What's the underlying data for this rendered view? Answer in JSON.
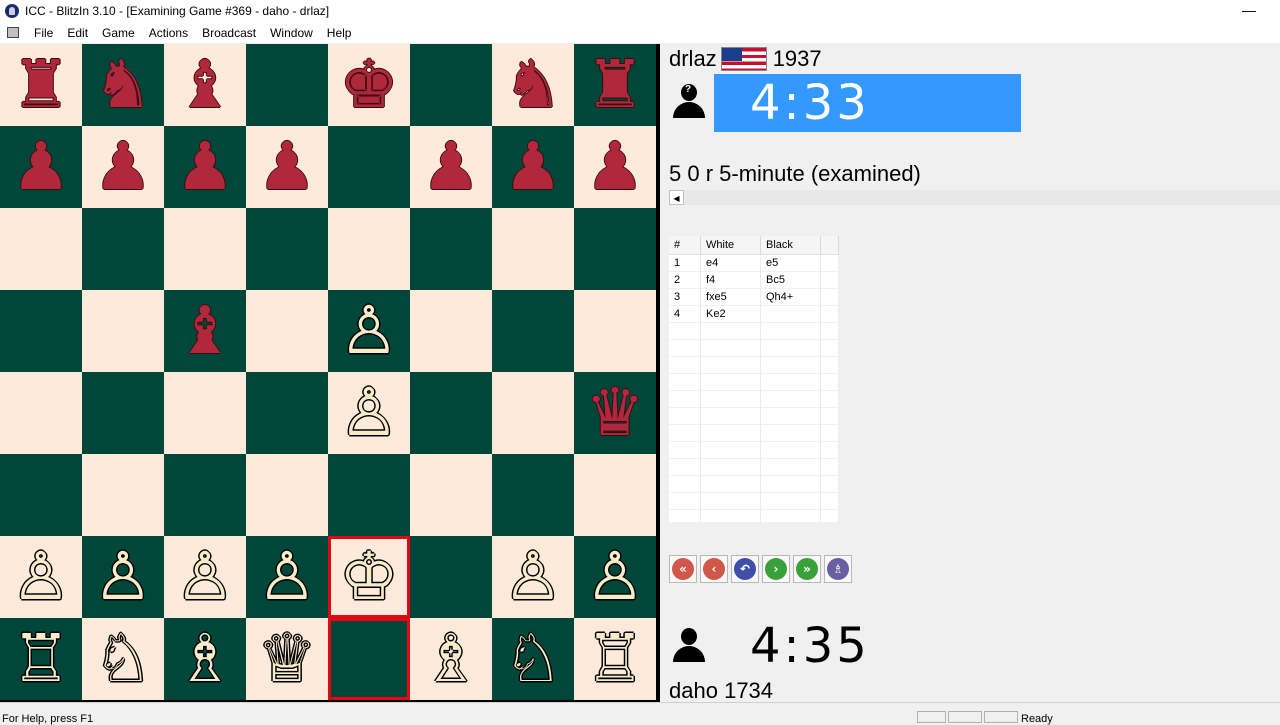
{
  "window": {
    "title": "ICC - BlitzIn 3.10 - [Examining Game #369 - daho - drlaz]",
    "minimize": "—"
  },
  "menu": [
    "File",
    "Edit",
    "Game",
    "Actions",
    "Broadcast",
    "Window",
    "Help"
  ],
  "board": {
    "light_color": "#feeadb",
    "dark_color": "#00473a",
    "highlight_color": "#e30613",
    "highlighted_squares": [
      "e2",
      "e1"
    ],
    "rows": [
      [
        "♜",
        "♞",
        "♝",
        "",
        "♚",
        "",
        "♞",
        "♜"
      ],
      [
        "♟",
        "♟",
        "♟",
        "♟",
        "",
        "♟",
        "♟",
        "♟"
      ],
      [
        "",
        "",
        "",
        "",
        "",
        "",
        "",
        ""
      ],
      [
        "",
        "",
        "♝",
        "",
        "♙",
        "",
        "",
        ""
      ],
      [
        "",
        "",
        "",
        "",
        "♙",
        "",
        "",
        "♛"
      ],
      [
        "",
        "",
        "",
        "",
        "",
        "",
        "",
        ""
      ],
      [
        "♙",
        "♙",
        "♙",
        "♙",
        "♔",
        "",
        "♙",
        "♙"
      ],
      [
        "♖",
        "♘",
        "♗",
        "♕",
        "",
        "♗",
        "♘",
        "♖"
      ]
    ],
    "colors": [
      [
        "b",
        "b",
        "b",
        "",
        "b",
        "",
        "b",
        "b"
      ],
      [
        "b",
        "b",
        "b",
        "b",
        "",
        "b",
        "b",
        "b"
      ],
      [
        "",
        "",
        "",
        "",
        "",
        "",
        "",
        ""
      ],
      [
        "",
        "",
        "b",
        "",
        "w",
        "",
        "",
        ""
      ],
      [
        "",
        "",
        "",
        "",
        "w",
        "",
        "",
        "b"
      ],
      [
        "",
        "",
        "",
        "",
        "",
        "",
        "",
        ""
      ],
      [
        "w",
        "w",
        "w",
        "w",
        "w",
        "",
        "w",
        "w"
      ],
      [
        "w",
        "w",
        "w",
        "w",
        "",
        "w",
        "w",
        "w"
      ]
    ]
  },
  "top_player": {
    "name": "drlaz",
    "rating": "1937",
    "flag": "us-flag-icon",
    "clock": "4:33",
    "clock_color": "#3399ff"
  },
  "game_description": "5 0 r 5-minute (examined)",
  "moves_table": {
    "headers": [
      "#",
      "White",
      "Black"
    ],
    "rows": [
      {
        "num": "1",
        "white": "e4",
        "black": "e5"
      },
      {
        "num": "2",
        "white": "f4",
        "black": "Bc5"
      },
      {
        "num": "3",
        "white": "fxe5",
        "black": "Qh4+"
      },
      {
        "num": "4",
        "white": "Ke2",
        "black": ""
      }
    ]
  },
  "nav_buttons": [
    {
      "name": "first-move-button",
      "glyph": "«",
      "color": "#d0574a"
    },
    {
      "name": "back-button",
      "glyph": "‹",
      "color": "#d0574a"
    },
    {
      "name": "undo-button",
      "glyph": "↶",
      "color": "#3f4fa8"
    },
    {
      "name": "forward-button",
      "glyph": "›",
      "color": "#3aa03a"
    },
    {
      "name": "last-move-button",
      "glyph": "»",
      "color": "#3aa03a"
    },
    {
      "name": "analysis-button",
      "glyph": "♗",
      "color": "#6a5fa0"
    }
  ],
  "bottom_player": {
    "name": "daho",
    "rating": "1734",
    "clock": "4:35"
  },
  "status": {
    "help_text": "For Help, press F1",
    "ready": "Ready"
  }
}
